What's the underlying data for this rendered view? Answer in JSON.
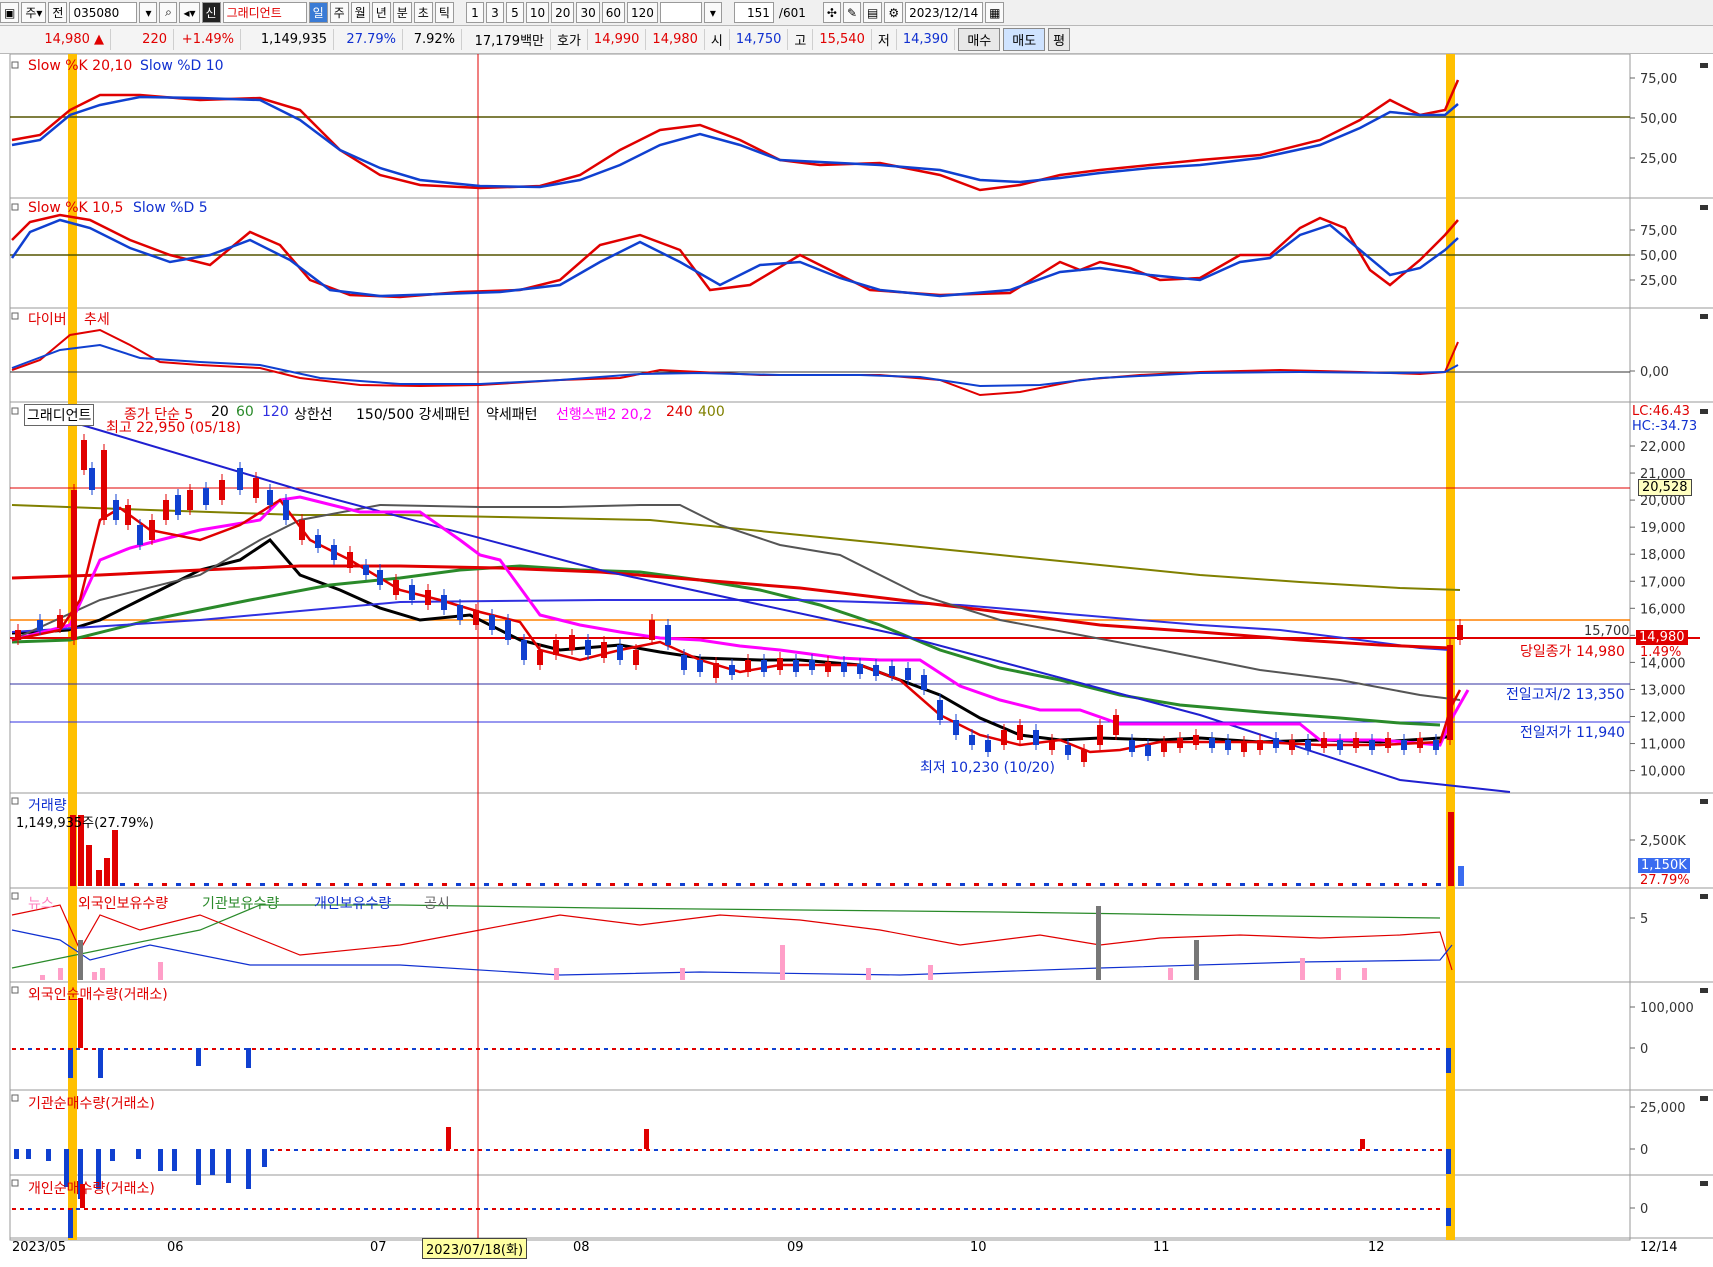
{
  "toolbar": {
    "period_select": "주",
    "prev_button": "전",
    "code": "035080",
    "new_badge": "신",
    "stock_name": "그래디언트",
    "timeframes": [
      "일",
      "주",
      "월",
      "년",
      "분",
      "초",
      "틱"
    ],
    "active_timeframe": "일",
    "intervals": [
      "1",
      "3",
      "5",
      "10",
      "20",
      "30",
      "60",
      "120"
    ],
    "count": "151",
    "count_total": "/601",
    "date": "2023/12/14"
  },
  "quote": {
    "price": "14,980 ▲",
    "change": "220",
    "change_pct": "+1.49%",
    "volume": "1,149,935",
    "volume_ratio": "27.79%",
    "turnover": "7.92%",
    "amount": "17,179백만",
    "ask_label": "호가",
    "ask": "14,990",
    "bid": "14,980",
    "open_label": "시",
    "open": "14,750",
    "high_label": "고",
    "high": "15,540",
    "low_label": "저",
    "low": "14,390",
    "buy_button": "매수",
    "sell_button": "매도",
    "eval_button": "평"
  },
  "panels": {
    "stoch1": {
      "title_k": "Slow %K 20,10",
      "title_d": "Slow %D 10",
      "ticks": [
        "75,00",
        "50,00",
        "25,00"
      ]
    },
    "stoch2": {
      "title_k": "Slow %K 10,5",
      "title_d": "Slow %D 5",
      "ticks": [
        "75,00",
        "50,00",
        "25,00"
      ]
    },
    "divergence": {
      "title_a": "다이버",
      "title_b": "추세",
      "ticks": [
        "0,00"
      ]
    },
    "price": {
      "name_tag": "그래디언트",
      "ma_legend": "종가 단순 5",
      "ma20": "20",
      "ma60": "60",
      "ma120": "120",
      "limit_line": "상한선",
      "pattern1": "150/500 강세패턴",
      "pattern2": "약세패턴",
      "span": "선행스팬2 20,2",
      "ma240": "240",
      "ma400": "400",
      "high_note": "최고 22,950 (05/18)",
      "low_note": "최저 10,230 (10/20)",
      "lc": "LC:46.43",
      "hc": "HC:-34.73",
      "price_tag": "20,528",
      "current_tag": "14,980",
      "current_pct": "1.49%",
      "level_15700": "15,700",
      "close_note": "당일종가 14,980",
      "prev_half": "전일고저/2 13,350",
      "prev_low": "전일저가 11,940",
      "ticks": [
        "22,000",
        "21,000",
        "20,000",
        "19,000",
        "18,000",
        "17,000",
        "16,000",
        "15,000",
        "14,000",
        "13,000",
        "12,000",
        "11,000",
        "10,000"
      ]
    },
    "volume": {
      "title": "거래량",
      "value": "1,149,935주(27.79%)",
      "tick": "2,500K",
      "tag": "1,150K",
      "tag_pct": "27.79%"
    },
    "holdings": {
      "news": "뉴스",
      "foreign": "외국인보유수량",
      "inst": "기관보유수량",
      "retail": "개인보유수량",
      "disclosure": "공시",
      "tick": "5"
    },
    "foreign_net": {
      "title": "외국인순매수량(거래소)",
      "ticks": [
        "100,000",
        "0"
      ]
    },
    "inst_net": {
      "title": "기관순매수량(거래소)",
      "ticks": [
        "25,000",
        "0"
      ]
    },
    "retail_net": {
      "title": "개인순매수량(거래소)",
      "ticks": [
        "0"
      ]
    }
  },
  "xaxis": {
    "labels": [
      "2023/05",
      "06",
      "07",
      "08",
      "09",
      "10",
      "11",
      "12"
    ],
    "cursor_date": "2023/07/18(화)",
    "right_label": "12/14"
  },
  "colors": {
    "up": "#e00000",
    "down": "#1040d0",
    "highlight": "#ffc000",
    "ma5": "#e00000",
    "ma20": "#000000",
    "ma60": "#2a8a2a",
    "ma120": "#3030e0",
    "span": "#ff00ff",
    "ma240": "#555555",
    "ma400": "#808000"
  }
}
